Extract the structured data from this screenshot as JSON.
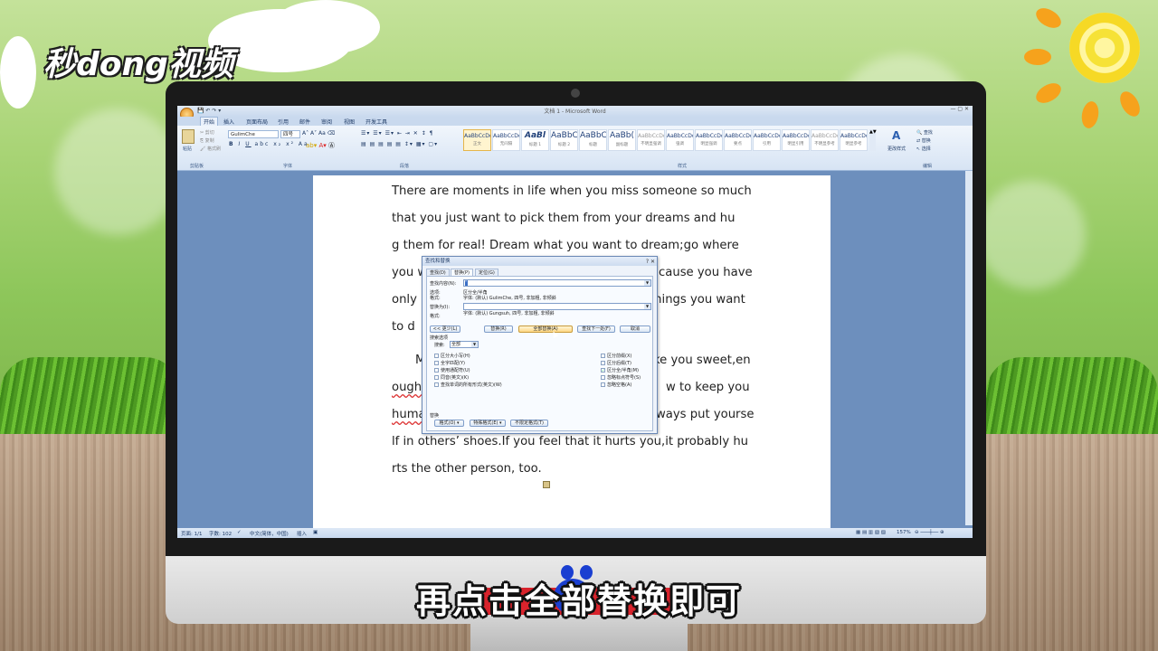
{
  "overlay": {
    "logo": "秒dong视频",
    "subtitle": "再点击全部替换即可"
  },
  "word": {
    "window_title": "文档 1 - Microsoft Word",
    "tabs": [
      "开始",
      "插入",
      "页面布局",
      "引用",
      "邮件",
      "审阅",
      "视图",
      "开发工具"
    ],
    "ribbon": {
      "clipboard_label": "剪贴板",
      "paste_label": "粘贴",
      "cut_label": "剪切",
      "copy_label": "复制",
      "format_painter_label": "格式刷",
      "font_name": "GulimChe",
      "font_size": "四号",
      "font_group_label": "字体",
      "paragraph_group_label": "段落",
      "styles_group_label": "样式",
      "editing_group_label": "编辑",
      "change_styles_label": "更改样式",
      "find_label": "查找",
      "replace_label": "替换",
      "select_label": "选择",
      "styles": [
        {
          "sample": "AaBbCcDd",
          "name": "正文"
        },
        {
          "sample": "AaBbCcDd",
          "name": "无间隔"
        },
        {
          "sample": "AaBl",
          "name": "标题 1"
        },
        {
          "sample": "AaBbC",
          "name": "标题 2"
        },
        {
          "sample": "AaBbC",
          "name": "标题"
        },
        {
          "sample": "AaBb(",
          "name": "副标题"
        },
        {
          "sample": "AaBbCcDd",
          "name": "不明显强调"
        },
        {
          "sample": "AaBbCcDd",
          "name": "强调"
        },
        {
          "sample": "AaBbCcDd",
          "name": "明显强调"
        },
        {
          "sample": "AaBbCcDd",
          "name": "要点"
        },
        {
          "sample": "AaBbCcDd",
          "name": "引用"
        },
        {
          "sample": "AaBbCcDd",
          "name": "明显引用"
        },
        {
          "sample": "AaBbCcDd",
          "name": "不明显参考"
        },
        {
          "sample": "AaBbCcDd",
          "name": "明显参考"
        }
      ]
    },
    "document_lines": [
      "There are moments in life when you miss someone so much",
      " that you just want to pick them from your dreams and hu",
      "g them for real! Dream what you want to dream;go where",
      "you w",
      "cause you have",
      "only",
      "things you want",
      " to d",
      "M",
      "ke you sweet,en",
      "ough",
      "w to keep you",
      "huma",
      "ways put yourse",
      "lf in others’ shoes.If you feel that it hurts you,it probably hu",
      "rts the other person, too."
    ],
    "status": {
      "page": "页面: 1/1",
      "words": "字数: 102",
      "language": "中文(简体，中国)",
      "mode": "插入",
      "zoom": "157%"
    },
    "dialog": {
      "title": "查找和替换",
      "tab_find": "查找(D)",
      "tab_replace": "替换(P)",
      "tab_goto": "定位(G)",
      "find_what_label": "查找内容(N):",
      "find_what_value": "“",
      "options_label": "选项:",
      "options_value": "区分全/半角",
      "format_label": "格式:",
      "find_format_value": "字体: (默认) GulimChe, 四号, 非加粗, 非倾斜",
      "replace_with_label": "替换为(I):",
      "replace_with_value": "",
      "replace_format_value": "字体: (默认) Gungsuh, 四号, 非加粗, 非倾斜",
      "less_button": "<< 更少(L)",
      "replace_button": "替换(R)",
      "replace_all_button": "全部替换(A)",
      "find_next_button": "查找下一处(F)",
      "cancel_button": "取消",
      "search_options_label": "搜索选项",
      "search_label": "搜索:",
      "search_value": "全部",
      "checkboxes_left": [
        {
          "label": "区分大小写(H)",
          "checked": false
        },
        {
          "label": "全字匹配(Y)",
          "checked": false
        },
        {
          "label": "使用通配符(U)",
          "checked": false
        },
        {
          "label": "同音(英文)(K)",
          "checked": false
        },
        {
          "label": "查找单词的所有形式(英文)(W)",
          "checked": false
        }
      ],
      "checkboxes_right": [
        {
          "label": "区分前缀(X)",
          "checked": false
        },
        {
          "label": "区分后缀(T)",
          "checked": false
        },
        {
          "label": "区分全/半角(M)",
          "checked": true
        },
        {
          "label": "忽略标点符号(S)",
          "checked": false
        },
        {
          "label": "忽略空格(A)",
          "checked": false
        }
      ],
      "replace_section_label": "替换",
      "format_button": "格式(O) ▾",
      "special_button": "特殊格式(E) ▾",
      "no_format_button": "不限定格式(T)"
    }
  }
}
